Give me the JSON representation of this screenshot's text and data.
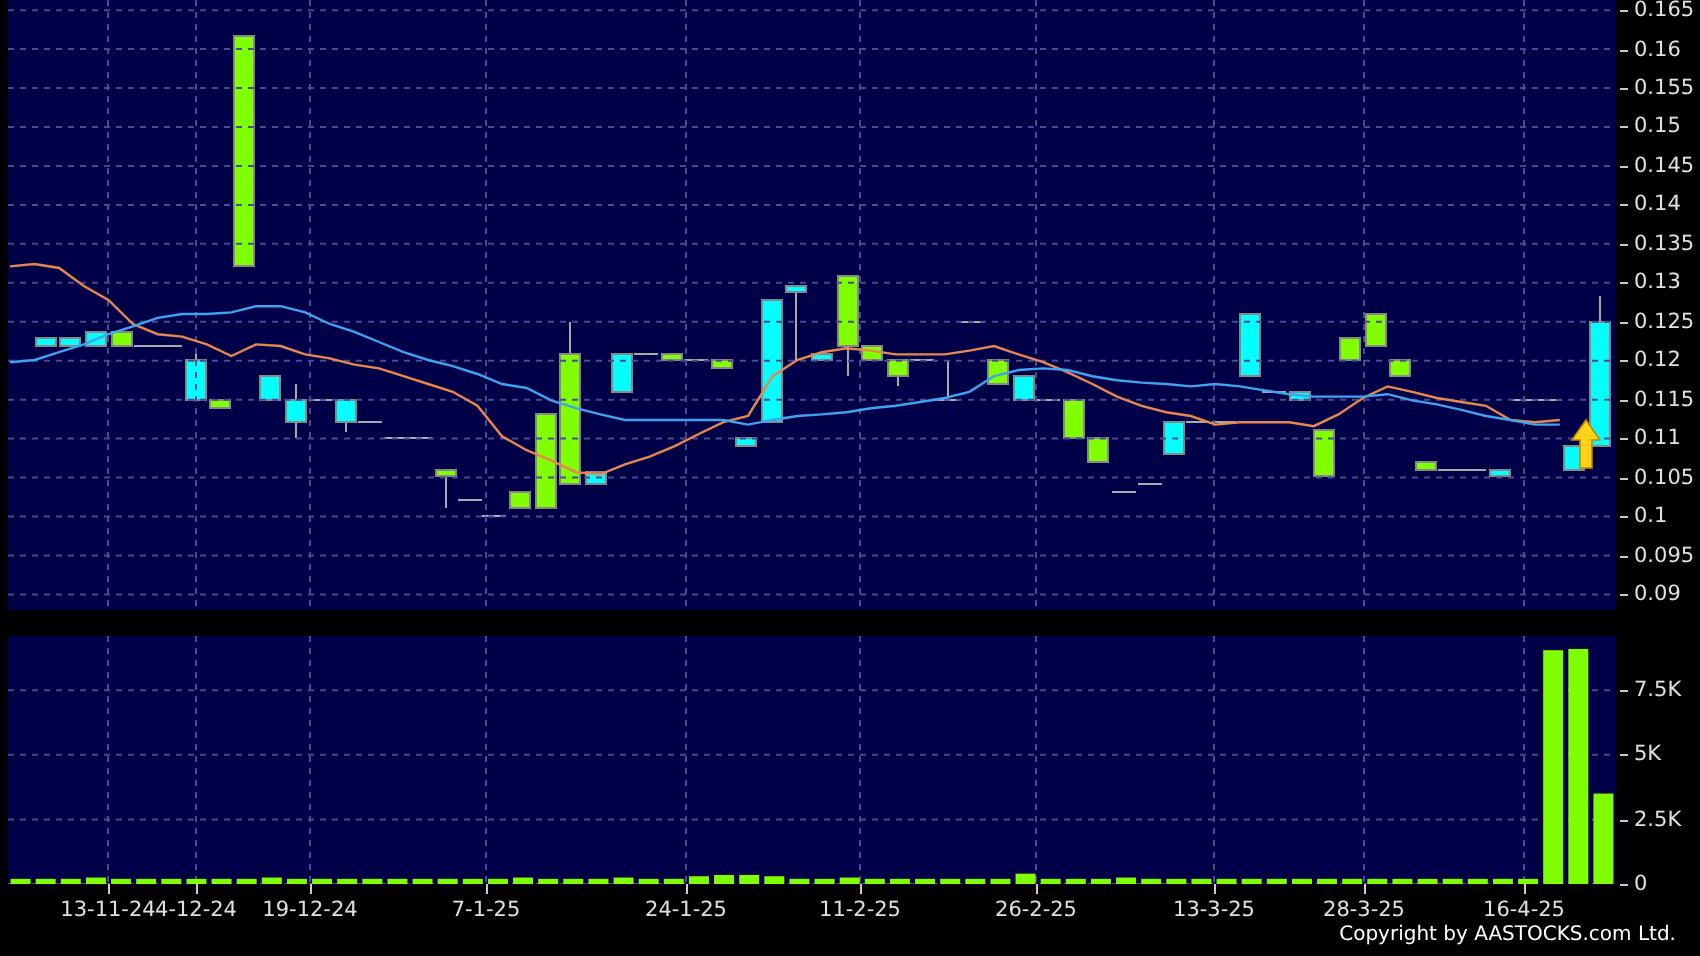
{
  "price_chart": {
    "chart_data": {
      "type": "line",
      "grid": true,
      "ylim": [
        0.088,
        0.1663
      ],
      "yticks": [
        {
          "value": 0.165,
          "label": "0.165"
        },
        {
          "value": 0.16,
          "label": "0.16"
        },
        {
          "value": 0.155,
          "label": "0.155"
        },
        {
          "value": 0.15,
          "label": "0.15"
        },
        {
          "value": 0.145,
          "label": "0.145"
        },
        {
          "value": 0.14,
          "label": "0.14"
        },
        {
          "value": 0.135,
          "label": "0.135"
        },
        {
          "value": 0.13,
          "label": "0.13"
        },
        {
          "value": 0.125,
          "label": "0.125"
        },
        {
          "value": 0.12,
          "label": "0.12"
        },
        {
          "value": 0.115,
          "label": "0.115"
        },
        {
          "value": 0.11,
          "label": "0.11"
        },
        {
          "value": 0.105,
          "label": "0.105"
        },
        {
          "value": 0.1,
          "label": "0.1"
        },
        {
          "value": 0.095,
          "label": "0.095"
        },
        {
          "value": 0.09,
          "label": "0.09"
        }
      ],
      "series": [
        {
          "color": "#e8874f",
          "values": [
            0.1321,
            0.1324,
            0.1319,
            0.1296,
            0.1278,
            0.1247,
            0.1234,
            0.1231,
            0.1221,
            0.1206,
            0.1221,
            0.1219,
            0.1208,
            0.1203,
            0.1195,
            0.119,
            0.118,
            0.117,
            0.116,
            0.1142,
            0.1103,
            0.1085,
            0.1072,
            0.1057,
            0.1054,
            0.1067,
            0.1077,
            0.109,
            0.1106,
            0.1121,
            0.1129,
            0.118,
            0.1201,
            0.1211,
            0.1216,
            0.1213,
            0.1208,
            0.1208,
            0.1208,
            0.1213,
            0.1219,
            0.1208,
            0.1198,
            0.1185,
            0.117,
            0.1154,
            0.1142,
            0.1134,
            0.1129,
            0.1118,
            0.1121,
            0.1121,
            0.1121,
            0.1116,
            0.1131,
            0.1152,
            0.1167,
            0.116,
            0.1152,
            0.1147,
            0.1142,
            0.1124,
            0.1121,
            0.1124
          ]
        },
        {
          "color": "#3fa3f0",
          "values": [
            0.1198,
            0.1201,
            0.1211,
            0.1221,
            0.1234,
            0.1244,
            0.1255,
            0.126,
            0.126,
            0.1262,
            0.127,
            0.127,
            0.1262,
            0.1247,
            0.1237,
            0.1224,
            0.1211,
            0.1201,
            0.1193,
            0.1183,
            0.117,
            0.1165,
            0.1149,
            0.1139,
            0.1131,
            0.1124,
            0.1124,
            0.1124,
            0.1124,
            0.1124,
            0.1118,
            0.1124,
            0.1129,
            0.1131,
            0.1134,
            0.1139,
            0.1142,
            0.1147,
            0.1152,
            0.116,
            0.118,
            0.1188,
            0.119,
            0.1188,
            0.118,
            0.1175,
            0.1172,
            0.117,
            0.1167,
            0.117,
            0.1167,
            0.1162,
            0.1157,
            0.1154,
            0.1154,
            0.1154,
            0.1157,
            0.1149,
            0.1144,
            0.1137,
            0.1129,
            0.1124,
            0.1118,
            0.1118
          ]
        }
      ]
    }
  },
  "volume_chart": {
    "chart_data": {
      "type": "bar",
      "grid": true,
      "ylim": [
        0,
        9.6
      ],
      "yticks": [
        {
          "value": 7.5,
          "label": "7.5K"
        },
        {
          "value": 5,
          "label": "5K"
        },
        {
          "value": 2.5,
          "label": "2.5K"
        },
        {
          "value": 0,
          "label": "0"
        }
      ],
      "values": [
        0.2,
        0.2,
        0.2,
        0.25,
        0.2,
        0.2,
        0.2,
        0.2,
        0.2,
        0.2,
        0.25,
        0.2,
        0.2,
        0.2,
        0.2,
        0.2,
        0.2,
        0.2,
        0.2,
        0.2,
        0.25,
        0.2,
        0.2,
        0.2,
        0.25,
        0.2,
        0.2,
        0.3,
        0.35,
        0.35,
        0.3,
        0.2,
        0.2,
        0.25,
        0.2,
        0.2,
        0.2,
        0.2,
        0.2,
        0.2,
        0.4,
        0.2,
        0.2,
        0.2,
        0.25,
        0.2,
        0.2,
        0.2,
        0.2,
        0.2,
        0.2,
        0.2,
        0.2,
        0.2,
        0.2,
        0.2,
        0.2,
        0.2,
        0.2,
        0.2,
        0.2,
        9.05,
        9.1,
        3.5
      ]
    }
  },
  "x_axis": {
    "labels": [
      "13-11-24",
      "4-12-24",
      "19-12-24",
      "7-1-25",
      "24-1-25",
      "11-2-25",
      "26-2-25",
      "13-3-25",
      "28-3-25",
      "16-4-25"
    ]
  },
  "footer": {
    "copyright": "Copyright by AASTOCKS.com Ltd."
  }
}
